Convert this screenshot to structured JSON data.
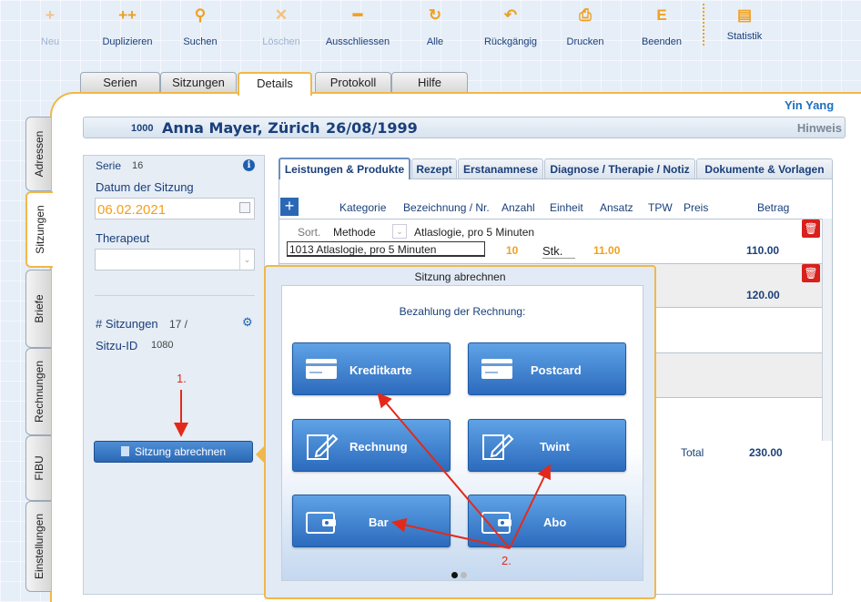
{
  "toolbar": {
    "items": [
      {
        "icon": "+",
        "label": "Neu",
        "disabled": true
      },
      {
        "icon": "++",
        "label": "Duplizieren",
        "disabled": false
      },
      {
        "icon": "⚲",
        "label": "Suchen",
        "disabled": false
      },
      {
        "icon": "✕",
        "label": "Löschen",
        "disabled": true
      },
      {
        "icon": "━",
        "label": "Ausschliessen",
        "disabled": false
      },
      {
        "icon": "↻",
        "label": "Alle",
        "disabled": false
      },
      {
        "icon": "↶",
        "label": "Rückgängig",
        "disabled": false
      },
      {
        "icon": "⎙",
        "label": "Drucken",
        "disabled": false
      },
      {
        "icon": "E",
        "label": "Beenden",
        "disabled": false
      },
      {
        "icon": "▤",
        "label": "Statistik",
        "disabled": false
      }
    ]
  },
  "top_tabs": [
    "Serien",
    "Sitzungen",
    "Details",
    "Protokoll",
    "Hilfe"
  ],
  "active_top_tab": "Details",
  "side_tabs": [
    "Adressen",
    "Sitzungen",
    "Briefe",
    "Rechnungen",
    "FIBU",
    "Einstellungen"
  ],
  "brand": "Yin Yang",
  "patient": {
    "id": "1000",
    "name": "Anna Mayer, Zürich",
    "birthdate": "26/08/1999",
    "hint_label": "Hinweis"
  },
  "left": {
    "serie_label": "Serie",
    "serie_value": "16",
    "date_label": "Datum der Sitzung",
    "date_value": "06.02.2021",
    "therapist_label": "Therapeut",
    "therapist_value": "",
    "sessions_label": "# Sitzungen",
    "sessions_value": "17 /",
    "sitzu_id_label": "Sitzu-ID",
    "sitzu_id_value": "1080",
    "bill_button": "Sitzung abrechnen",
    "annotation_1": "1."
  },
  "sub_tabs": [
    "Leistungen & Produkte",
    "Rezept",
    "Erstanamnese",
    "Diagnose / Therapie / Notiz",
    "Dokumente  & Vorlagen"
  ],
  "active_sub_tab": "Leistungen & Produkte",
  "columns": [
    "Kategorie",
    "Bezeichnung / Nr.",
    "Anzahl",
    "Einheit",
    "Ansatz",
    "TPW",
    "Preis",
    "Betrag"
  ],
  "line1": {
    "sort_label": "Sort.",
    "methode_label": "Methode",
    "methode_value": "Atlaslogie, pro 5 Minuten",
    "description": "1013 Atlaslogie, pro 5 Minuten",
    "quantity": "10",
    "unit": "Stk.",
    "rate": "11.00",
    "amount": "110.00"
  },
  "line2": {
    "amount": "120.00"
  },
  "total": {
    "label": "Total",
    "value": "230.00"
  },
  "popover": {
    "title": "Sitzung abrechnen",
    "subtitle": "Bezahlung der Rechnung:",
    "buttons": [
      "Kreditkarte",
      "Postcard",
      "Rechnung",
      "Twint",
      "Bar",
      "Abo"
    ],
    "annotation_2": "2."
  },
  "colors": {
    "accent": "#f0a020",
    "brand": "#1f6fc0",
    "annotation": "#e32a1a",
    "delete": "#d8201c"
  }
}
